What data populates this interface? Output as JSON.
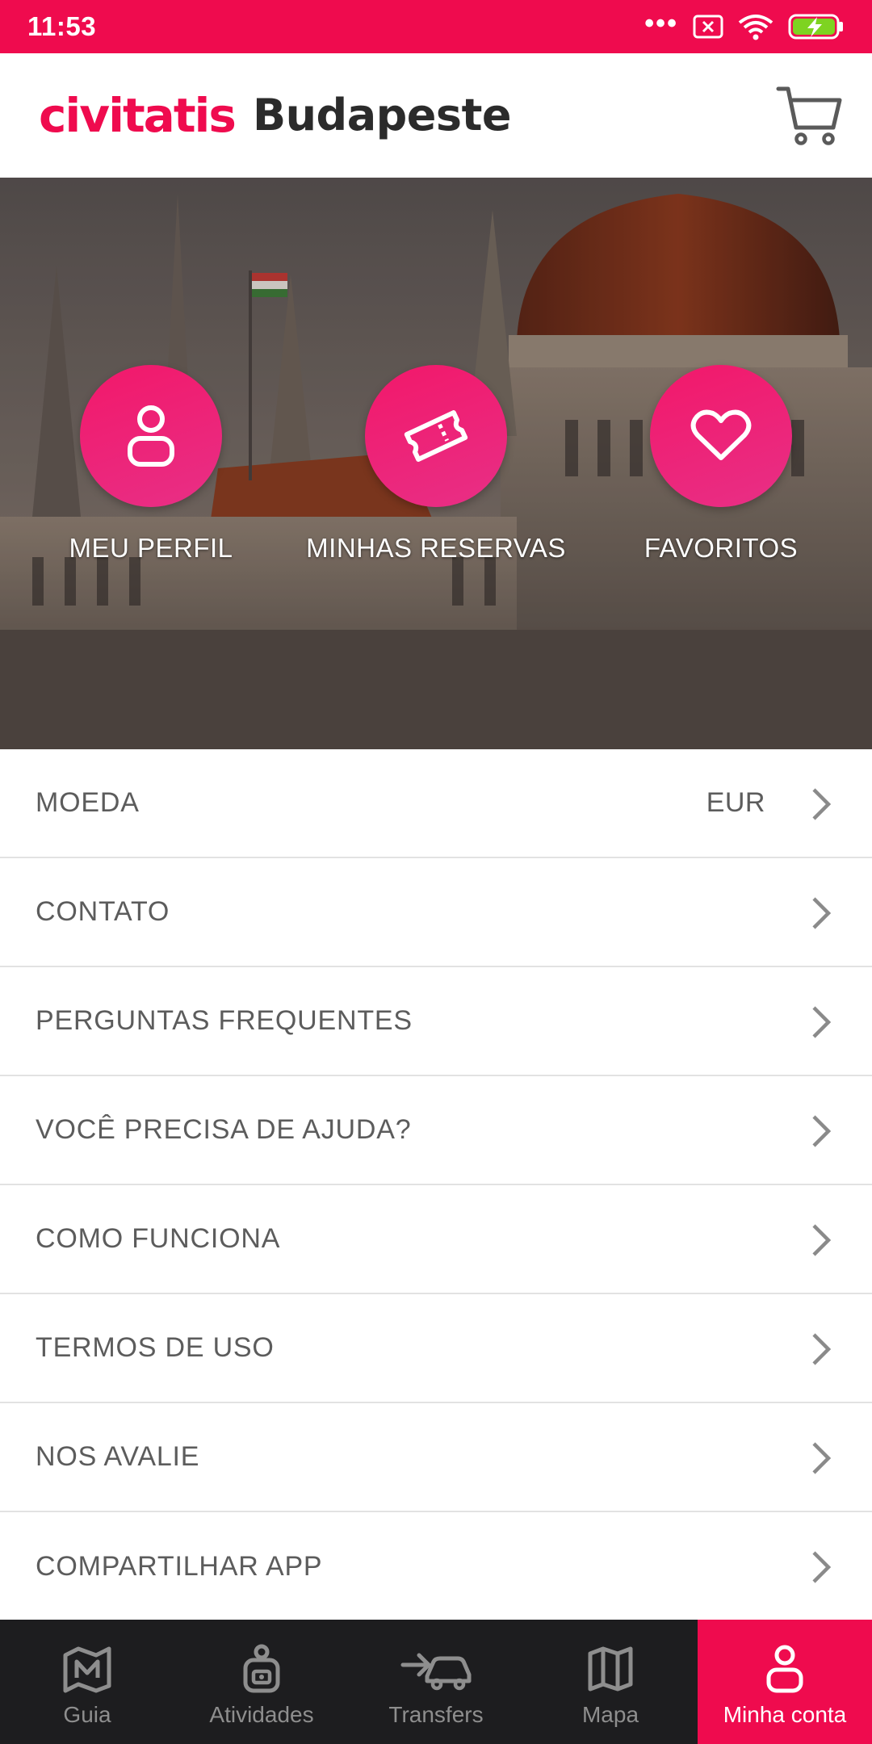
{
  "status_bar": {
    "time": "11:53"
  },
  "header": {
    "brand": "civitatis",
    "city": "Budapeste"
  },
  "hero": {
    "actions": [
      {
        "label": "MEU PERFIL",
        "icon": "user-icon"
      },
      {
        "label": "MINHAS RESERVAS",
        "icon": "ticket-icon"
      },
      {
        "label": "FAVORITOS",
        "icon": "heart-icon"
      }
    ]
  },
  "menu": {
    "items": [
      {
        "label": "MOEDA",
        "value": "EUR"
      },
      {
        "label": "CONTATO"
      },
      {
        "label": "PERGUNTAS FREQUENTES"
      },
      {
        "label": "VOCÊ PRECISA DE AJUDA?"
      },
      {
        "label": "COMO FUNCIONA"
      },
      {
        "label": "TERMOS DE USO"
      },
      {
        "label": "NOS AVALIE"
      },
      {
        "label": "COMPARTILHAR APP"
      }
    ]
  },
  "bottom_nav": {
    "items": [
      {
        "label": "Guia",
        "icon": "guide-map-icon"
      },
      {
        "label": "Atividades",
        "icon": "activities-icon"
      },
      {
        "label": "Transfers",
        "icon": "transfer-car-icon"
      },
      {
        "label": "Mapa",
        "icon": "map-icon"
      },
      {
        "label": "Minha conta",
        "icon": "user-icon",
        "active": true
      }
    ]
  },
  "colors": {
    "brand": "#ef0b4e",
    "nav_bg": "#1d1d1f",
    "text": "#5c5c5c"
  }
}
